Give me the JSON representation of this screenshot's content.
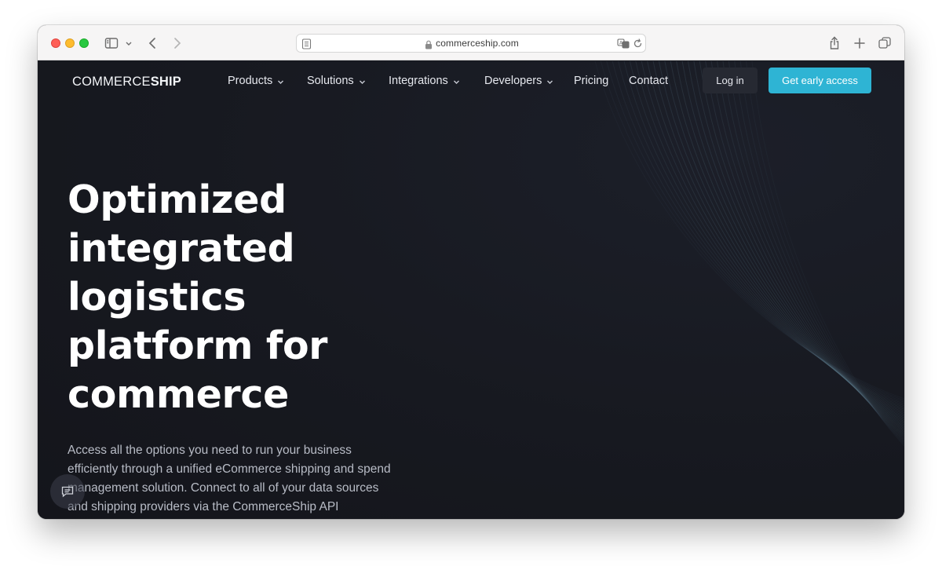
{
  "browser": {
    "url": "commerceship.com",
    "icons": [
      "sidebar-icon",
      "chevron-down-icon",
      "back-icon",
      "forward-icon",
      "reader-icon",
      "lock-icon",
      "translate-icon",
      "reload-icon",
      "share-icon",
      "new-tab-icon",
      "tabs-overview-icon"
    ]
  },
  "brand": {
    "logo_part1": "COMMERCE",
    "logo_part2": "SHIP"
  },
  "nav": {
    "items": [
      {
        "label": "Products",
        "has_dropdown": true
      },
      {
        "label": "Solutions",
        "has_dropdown": true
      },
      {
        "label": "Integrations",
        "has_dropdown": true
      },
      {
        "label": "Developers",
        "has_dropdown": true
      },
      {
        "label": "Pricing",
        "has_dropdown": false
      },
      {
        "label": "Contact",
        "has_dropdown": false
      }
    ],
    "login_label": "Log in",
    "cta_label": "Get early access"
  },
  "hero": {
    "title": "Optimized integrated logistics platform for commerce",
    "subtitle": "Access all the options you need to run your business efficiently through a unified eCommerce shipping and spend management solution. Connect to all of your data sources and shipping providers via the CommerceShip API"
  },
  "colors": {
    "page_bg": "#16181f",
    "accent": "#2eb4d4",
    "login_bg": "#262932",
    "text_primary": "#ffffff",
    "text_muted": "#b8bcc6"
  },
  "chat": {
    "icon": "chat-icon"
  }
}
